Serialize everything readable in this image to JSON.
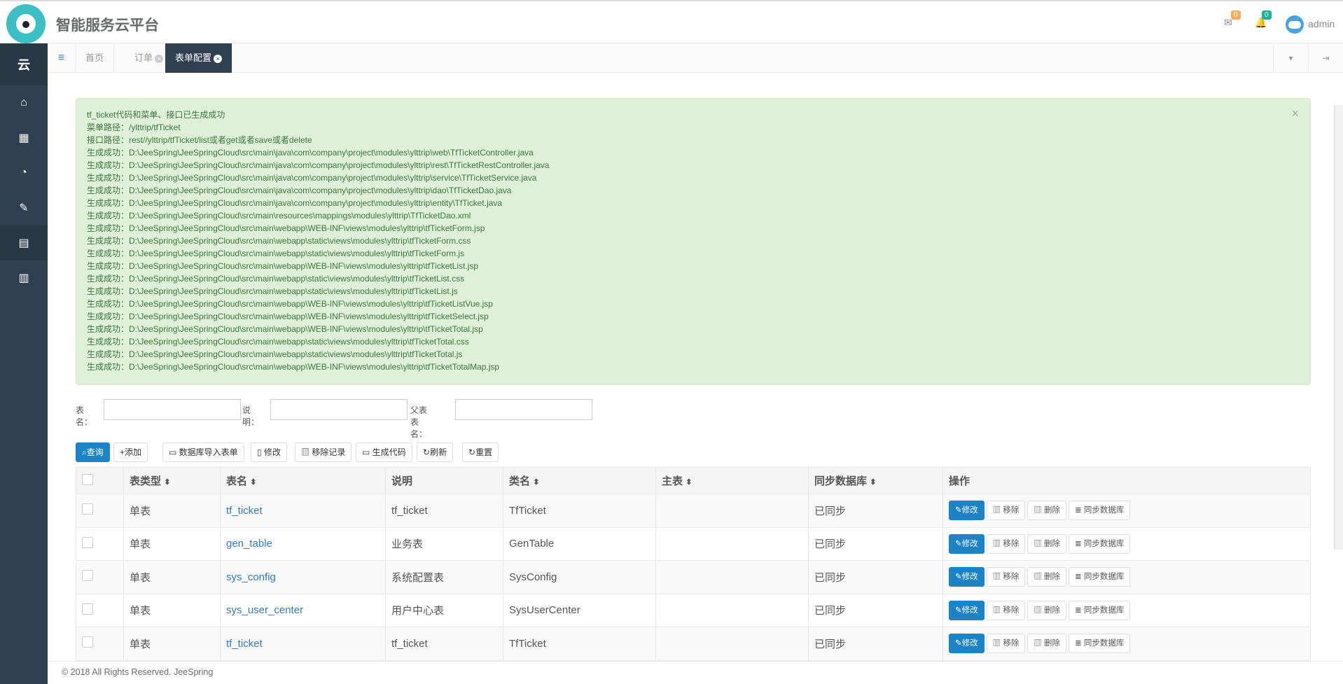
{
  "header": {
    "app_title": "智能服务云平台",
    "mail_count": "0",
    "bell_count": "0",
    "user": "admin"
  },
  "sidebar": {
    "brand": "云",
    "items": [
      "home-icon",
      "dashboard-icon",
      "gauge-icon",
      "wrench-icon",
      "grid-icon",
      "map-icon"
    ]
  },
  "tabs": [
    {
      "label": "首页"
    },
    {
      "label": "订单"
    },
    {
      "label": "表单配置"
    }
  ],
  "alert": {
    "lines": [
      "tf_ticket代码和菜单、接口已生成成功",
      "菜单路径：/ylttrip/tfTicket",
      "接口路径：rest//ylttrip/tfTicket/list或者get或者save或者delete",
      "生成成功：D:\\JeeSpring\\JeeSpringCloud\\src\\main\\java\\com\\company\\project\\modules\\ylttrip\\web\\TfTicketController.java",
      "生成成功：D:\\JeeSpring\\JeeSpringCloud\\src\\main\\java\\com\\company\\project\\modules\\ylttrip\\rest\\TfTicketRestController.java",
      "生成成功：D:\\JeeSpring\\JeeSpringCloud\\src\\main\\java\\com\\company\\project\\modules\\ylttrip\\service\\TfTicketService.java",
      "生成成功：D:\\JeeSpring\\JeeSpringCloud\\src\\main\\java\\com\\company\\project\\modules\\ylttrip\\dao\\TfTicketDao.java",
      "生成成功：D:\\JeeSpring\\JeeSpringCloud\\src\\main\\java\\com\\company\\project\\modules\\ylttrip\\entity\\TfTicket.java",
      "生成成功：D:\\JeeSpring\\JeeSpringCloud\\src\\main\\resources\\mappings\\modules\\ylttrip\\TfTicketDao.xml",
      "生成成功：D:\\JeeSpring\\JeeSpringCloud\\src\\main\\webapp\\WEB-INF\\views\\modules\\ylttrip\\tfTicketForm.jsp",
      "生成成功：D:\\JeeSpring\\JeeSpringCloud\\src\\main\\webapp\\static\\views\\modules\\ylttrip\\tfTicketForm.css",
      "生成成功：D:\\JeeSpring\\JeeSpringCloud\\src\\main\\webapp\\static\\views\\modules\\ylttrip\\tfTicketForm.js",
      "生成成功：D:\\JeeSpring\\JeeSpringCloud\\src\\main\\webapp\\WEB-INF\\views\\modules\\ylttrip\\tfTicketList.jsp",
      "生成成功：D:\\JeeSpring\\JeeSpringCloud\\src\\main\\webapp\\static\\views\\modules\\ylttrip\\tfTicketList.css",
      "生成成功：D:\\JeeSpring\\JeeSpringCloud\\src\\main\\webapp\\static\\views\\modules\\ylttrip\\tfTicketList.js",
      "生成成功：D:\\JeeSpring\\JeeSpringCloud\\src\\main\\webapp\\WEB-INF\\views\\modules\\ylttrip\\tfTicketListVue.jsp",
      "生成成功：D:\\JeeSpring\\JeeSpringCloud\\src\\main\\webapp\\WEB-INF\\views\\modules\\ylttrip\\tfTicketSelect.jsp",
      "生成成功：D:\\JeeSpring\\JeeSpringCloud\\src\\main\\webapp\\WEB-INF\\views\\modules\\ylttrip\\tfTicketTotal.jsp",
      "生成成功：D:\\JeeSpring\\JeeSpringCloud\\src\\main\\webapp\\static\\views\\modules\\ylttrip\\tfTicketTotal.css",
      "生成成功：D:\\JeeSpring\\JeeSpringCloud\\src\\main\\webapp\\static\\views\\modules\\ylttrip\\tfTicketTotal.js",
      "生成成功：D:\\JeeSpring\\JeeSpringCloud\\src\\main\\webapp\\WEB-INF\\views\\modules\\ylttrip\\tfTicketTotalMap.jsp"
    ]
  },
  "search": {
    "table_name_label": "表名：",
    "comments_label": "说明：",
    "parent_table_label": "父表表名："
  },
  "toolbar": {
    "query": "查询",
    "add": "添加",
    "import": "数据库导入表单",
    "edit": "修改",
    "remove_record": "移除记录",
    "generate": "生成代码",
    "refresh": "刷新",
    "reset": "重置"
  },
  "table": {
    "columns": [
      "表类型",
      "表名",
      "说明",
      "类名",
      "主表",
      "同步数据库",
      "操作"
    ],
    "rows": [
      {
        "type": "单表",
        "name": "tf_ticket",
        "comments": "tf_ticket",
        "class_name": "TfTicket",
        "parent": "",
        "sync": "已同步"
      },
      {
        "type": "单表",
        "name": "gen_table",
        "comments": "业务表",
        "class_name": "GenTable",
        "parent": "",
        "sync": "已同步"
      },
      {
        "type": "单表",
        "name": "sys_config",
        "comments": "系统配置表",
        "class_name": "SysConfig",
        "parent": "",
        "sync": "已同步"
      },
      {
        "type": "单表",
        "name": "sys_user_center",
        "comments": "用户中心表",
        "class_name": "SysUserCenter",
        "parent": "",
        "sync": "已同步"
      },
      {
        "type": "单表",
        "name": "tf_ticket",
        "comments": "tf_ticket",
        "class_name": "TfTicket",
        "parent": "",
        "sync": "已同步"
      }
    ],
    "actions": {
      "edit": "修改",
      "remove": "移除",
      "delete": "删除",
      "sync": "同步数据库"
    }
  },
  "footer": {
    "copyright": "© 2018 All Rights Reserved. JeeSpring"
  }
}
